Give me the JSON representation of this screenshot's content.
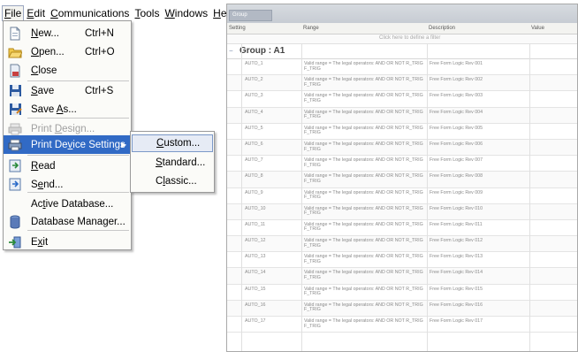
{
  "menubar": {
    "items": [
      {
        "pre": "",
        "u": "F",
        "post": "ile",
        "active": true
      },
      {
        "pre": "",
        "u": "E",
        "post": "dit"
      },
      {
        "pre": "",
        "u": "C",
        "post": "ommunications"
      },
      {
        "pre": "",
        "u": "T",
        "post": "ools"
      },
      {
        "pre": "",
        "u": "W",
        "post": "indows"
      },
      {
        "pre": "",
        "u": "H",
        "post": "elp"
      }
    ]
  },
  "file_menu": {
    "items": [
      {
        "icon": "new-document-icon",
        "pre": "",
        "u": "N",
        "post": "ew...",
        "shortcut": "Ctrl+N"
      },
      {
        "icon": "open-folder-icon",
        "pre": "",
        "u": "O",
        "post": "pen...",
        "shortcut": "Ctrl+O"
      },
      {
        "icon": "close-document-icon",
        "pre": "",
        "u": "C",
        "post": "lose",
        "shortcut": ""
      },
      {
        "icon": "save-disk-icon",
        "pre": "",
        "u": "S",
        "post": "ave",
        "shortcut": "Ctrl+S"
      },
      {
        "icon": "save-as-disk-icon",
        "pre": "Save ",
        "u": "A",
        "post": "s...",
        "shortcut": ""
      },
      {
        "icon": "print-design-icon",
        "pre": "Print ",
        "u": "D",
        "post": "esign...",
        "shortcut": "",
        "disabled": true
      },
      {
        "icon": "print-device-settings-icon",
        "pre": "Print De",
        "u": "v",
        "post": "ice Settings",
        "shortcut": "",
        "highlighted": true,
        "submenu": true
      },
      {
        "icon": "read-icon",
        "pre": "",
        "u": "R",
        "post": "ead",
        "shortcut": ""
      },
      {
        "icon": "send-icon",
        "pre": "S",
        "u": "e",
        "post": "nd...",
        "shortcut": ""
      },
      {
        "icon": "",
        "pre": "Ac",
        "u": "t",
        "post": "ive Database...",
        "shortcut": ""
      },
      {
        "icon": "database-manager-icon",
        "pre": "Database Manager...",
        "u": "",
        "post": "",
        "shortcut": ""
      },
      {
        "icon": "exit-icon",
        "pre": "E",
        "u": "x",
        "post": "it",
        "shortcut": ""
      }
    ]
  },
  "submenu": {
    "items": [
      {
        "pre": "",
        "u": "C",
        "post": "ustom...",
        "selected": true
      },
      {
        "pre": "",
        "u": "S",
        "post": "tandard..."
      },
      {
        "pre": "C",
        "u": "l",
        "post": "assic..."
      }
    ]
  },
  "grid": {
    "group_tag": "Group",
    "columns": [
      "Setting",
      "Range",
      "Description",
      "Value"
    ],
    "filter_text": "Click here to define a filter",
    "group_title": "Group : A1",
    "rows": [
      {
        "setting": "AUTO_1",
        "range": "Valid range = The legal operators: AND OR NOT R_TRIG F_TRIG",
        "description": "Free Form Logic Rev 001"
      },
      {
        "setting": "AUTO_2",
        "range": "Valid range = The legal operators: AND OR NOT R_TRIG F_TRIG",
        "description": "Free Form Logic Rev 002"
      },
      {
        "setting": "AUTO_3",
        "range": "Valid range = The legal operators: AND OR NOT R_TRIG F_TRIG",
        "description": "Free Form Logic Rev 003"
      },
      {
        "setting": "AUTO_4",
        "range": "Valid range = The legal operators: AND OR NOT R_TRIG F_TRIG",
        "description": "Free Form Logic Rev 004"
      },
      {
        "setting": "AUTO_5",
        "range": "Valid range = The legal operators: AND OR NOT R_TRIG F_TRIG",
        "description": "Free Form Logic Rev 005"
      },
      {
        "setting": "AUTO_6",
        "range": "Valid range = The legal operators: AND OR NOT R_TRIG F_TRIG",
        "description": "Free Form Logic Rev 006"
      },
      {
        "setting": "AUTO_7",
        "range": "Valid range = The legal operators: AND OR NOT R_TRIG F_TRIG",
        "description": "Free Form Logic Rev 007"
      },
      {
        "setting": "AUTO_8",
        "range": "Valid range = The legal operators: AND OR NOT R_TRIG F_TRIG",
        "description": "Free Form Logic Rev 008"
      },
      {
        "setting": "AUTO_9",
        "range": "Valid range = The legal operators: AND OR NOT R_TRIG F_TRIG",
        "description": "Free Form Logic Rev 009"
      },
      {
        "setting": "AUTO_10",
        "range": "Valid range = The legal operators: AND OR NOT R_TRIG F_TRIG",
        "description": "Free Form Logic Rev 010"
      },
      {
        "setting": "AUTO_11",
        "range": "Valid range = The legal operators: AND OR NOT R_TRIG F_TRIG",
        "description": "Free Form Logic Rev 011"
      },
      {
        "setting": "AUTO_12",
        "range": "Valid range = The legal operators: AND OR NOT R_TRIG F_TRIG",
        "description": "Free Form Logic Rev 012"
      },
      {
        "setting": "AUTO_13",
        "range": "Valid range = The legal operators: AND OR NOT R_TRIG F_TRIG",
        "description": "Free Form Logic Rev 013"
      },
      {
        "setting": "AUTO_14",
        "range": "Valid range = The legal operators: AND OR NOT R_TRIG F_TRIG",
        "description": "Free Form Logic Rev 014"
      },
      {
        "setting": "AUTO_15",
        "range": "Valid range = The legal operators: AND OR NOT R_TRIG F_TRIG",
        "description": "Free Form Logic Rev 015"
      },
      {
        "setting": "AUTO_16",
        "range": "Valid range = The legal operators: AND OR NOT R_TRIG F_TRIG",
        "description": "Free Form Logic Rev 016"
      },
      {
        "setting": "AUTO_17",
        "range": "Valid range = The legal operators: AND OR NOT R_TRIG F_TRIG",
        "description": "Free Form Logic Rev 017"
      }
    ]
  }
}
